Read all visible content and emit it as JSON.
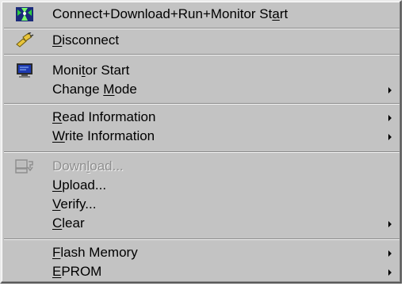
{
  "menu": {
    "connect_download": {
      "label_before": "Connect+Download+Run+Monitor St",
      "accel": "a",
      "label_after": "rt",
      "icon": "connect-run-icon"
    },
    "disconnect": {
      "label_before": "",
      "accel": "D",
      "label_after": "isconnect",
      "icon": "disconnect-plug-icon"
    },
    "monitor_start": {
      "label_before": "Moni",
      "accel": "t",
      "label_after": "or Start",
      "icon": "monitor-icon"
    },
    "change_mode": {
      "label_before": "Change ",
      "accel": "M",
      "label_after": "ode"
    },
    "read_information": {
      "label_before": "",
      "accel": "R",
      "label_after": "ead Information"
    },
    "write_information": {
      "label_before": "",
      "accel": "W",
      "label_after": "rite Information"
    },
    "download": {
      "label_before": "Down",
      "accel": "l",
      "label_after": "oad...",
      "icon": "download-icon"
    },
    "upload": {
      "label_before": "",
      "accel": "U",
      "label_after": "pload..."
    },
    "verify": {
      "label_before": "",
      "accel": "V",
      "label_after": "erify..."
    },
    "clear": {
      "label_before": "",
      "accel": "C",
      "label_after": "lear"
    },
    "flash_memory": {
      "label_before": "",
      "accel": "F",
      "label_after": "lash Memory"
    },
    "eprom": {
      "label_before": "",
      "accel": "E",
      "label_after": "PROM"
    }
  }
}
